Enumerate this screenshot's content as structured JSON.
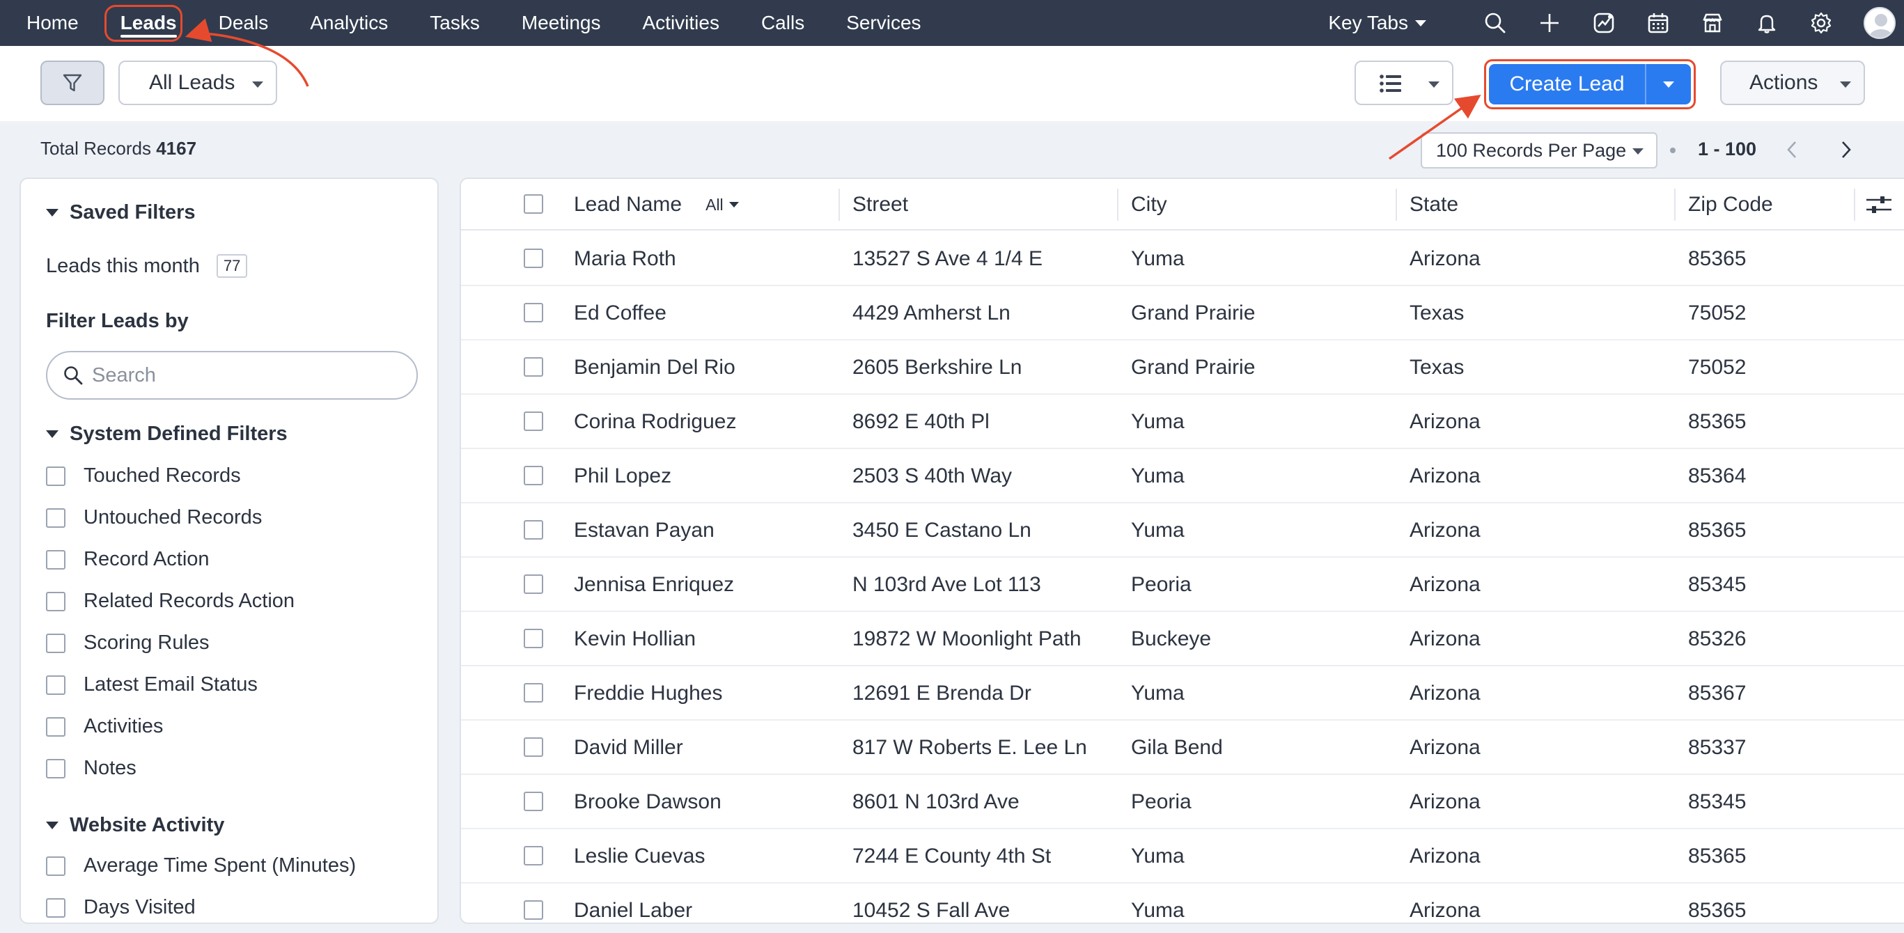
{
  "nav": {
    "tabs": [
      "Home",
      "Leads",
      "Deals",
      "Analytics",
      "Tasks",
      "Meetings",
      "Activities",
      "Calls",
      "Services"
    ],
    "active_tab": "Leads",
    "key_tabs_label": "Key Tabs",
    "icons": [
      "search-icon",
      "plus-icon",
      "signals-icon",
      "calendar-icon",
      "marketplace-icon",
      "bell-icon",
      "gear-icon"
    ]
  },
  "toolbar": {
    "view_label": "All Leads",
    "create_label": "Create Lead",
    "actions_label": "Actions"
  },
  "info": {
    "total_label": "Total Records",
    "total_value": "4167",
    "per_page": "100 Records Per Page",
    "range": "1 - 100"
  },
  "sidebar": {
    "saved_filters_title": "Saved Filters",
    "saved_item_label": "Leads this month",
    "saved_item_count": "77",
    "filter_by_title": "Filter Leads by",
    "search_placeholder": "Search",
    "system_title": "System Defined Filters",
    "system_filters": [
      "Touched Records",
      "Untouched Records",
      "Record Action",
      "Related Records Action",
      "Scoring Rules",
      "Latest Email Status",
      "Activities",
      "Notes"
    ],
    "website_title": "Website Activity",
    "website_filters": [
      "Average Time Spent (Minutes)",
      "Days Visited"
    ]
  },
  "table": {
    "columns": [
      "Lead Name",
      "Street",
      "City",
      "State",
      "Zip Code"
    ],
    "name_filter": "All",
    "rows": [
      [
        "Maria Roth",
        "13527 S Ave 4 1/4 E",
        "Yuma",
        "Arizona",
        "85365"
      ],
      [
        "Ed Coffee",
        "4429 Amherst Ln",
        "Grand Prairie",
        "Texas",
        "75052"
      ],
      [
        "Benjamin Del Rio",
        "2605 Berkshire Ln",
        "Grand Prairie",
        "Texas",
        "75052"
      ],
      [
        "Corina Rodriguez",
        "8692 E 40th Pl",
        "Yuma",
        "Arizona",
        "85365"
      ],
      [
        "Phil Lopez",
        "2503 S 40th Way",
        "Yuma",
        "Arizona",
        "85364"
      ],
      [
        "Estavan Payan",
        "3450 E Castano Ln",
        "Yuma",
        "Arizona",
        "85365"
      ],
      [
        "Jennisa Enriquez",
        "N 103rd Ave Lot 113",
        "Peoria",
        "Arizona",
        "85345"
      ],
      [
        "Kevin Hollian",
        "19872 W Moonlight Path",
        "Buckeye",
        "Arizona",
        "85326"
      ],
      [
        "Freddie Hughes",
        "12691 E Brenda Dr",
        "Yuma",
        "Arizona",
        "85367"
      ],
      [
        "David Miller",
        "817 W Roberts E. Lee Ln",
        "Gila Bend",
        "Arizona",
        "85337"
      ],
      [
        "Brooke Dawson",
        "8601 N 103rd Ave",
        "Peoria",
        "Arizona",
        "85345"
      ],
      [
        "Leslie Cuevas",
        "7244 E County 4th St",
        "Yuma",
        "Arizona",
        "85365"
      ],
      [
        "Daniel Laber",
        "10452 S Fall Ave",
        "Yuma",
        "Arizona",
        "85365"
      ]
    ]
  },
  "colors": {
    "nav_bg": "#313b4d",
    "primary": "#2b7bf0",
    "annotation": "#e64a2e"
  }
}
